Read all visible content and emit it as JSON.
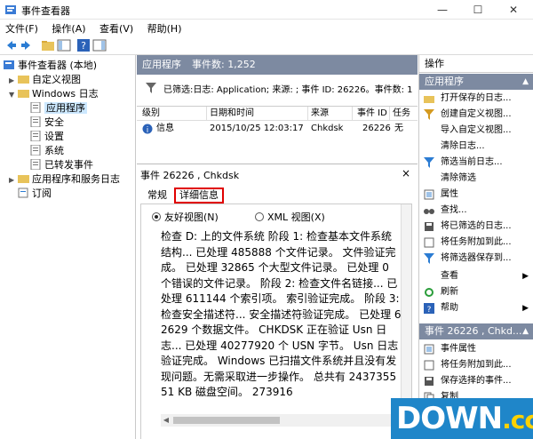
{
  "window": {
    "title": "事件查看器",
    "minimize": "—",
    "maximize": "☐",
    "close": "✕"
  },
  "menu": [
    "文件(F)",
    "操作(A)",
    "查看(V)",
    "帮助(H)"
  ],
  "tree": {
    "items": [
      {
        "label": "事件查看器 (本地)"
      },
      {
        "label": "自定义视图"
      },
      {
        "label": "Windows 日志"
      },
      {
        "label": "应用程序"
      },
      {
        "label": "安全"
      },
      {
        "label": "设置"
      },
      {
        "label": "系统"
      },
      {
        "label": "已转发事件"
      },
      {
        "label": "应用程序和服务日志"
      },
      {
        "label": "订阅"
      }
    ]
  },
  "main": {
    "header_title": "应用程序",
    "event_count": "事件数: 1,252",
    "filter_text": "已筛选:日志: Application; 来源: ; 事件 ID: 26226。事件数: 1",
    "columns": [
      "级别",
      "日期和时间",
      "来源",
      "事件 ID",
      "任务"
    ],
    "row": {
      "level": "信息",
      "datetime": "2015/10/25 12:03:17",
      "source": "Chkdsk",
      "event_id": "26226",
      "task": "无"
    }
  },
  "detail": {
    "title": "事件 26226 , Chkdsk",
    "close": "×",
    "tabs": [
      "常规",
      "详细信息"
    ],
    "radio_friendly": "友好视图(N)",
    "radio_xml": "XML 视图(X)",
    "text": "检查 D: 上的文件系统 阶段 1: 检查基本文件系统结构... 已处理 485888 个文件记录。 文件验证完成。 已处理 32865 个大型文件记录。 已处理 0 个错误的文件记录。 阶段 2: 检查文件名链接... 已处理 611144 个索引项。 索引验证完成。 阶段 3: 检查安全描述符... 安全描述符验证完成。 已处理 62629 个数据文件。 CHKDSK 正在验证 Usn 日志... 已处理 40277920 个 USN 字节。 Usn 日志验证完成。 Windows 已扫描文件系统并且没有发现问题。无需采取进一步操作。 总共有 243735551 KB 磁盘空间。 273916"
  },
  "actions": {
    "title": "操作",
    "group1": "应用程序",
    "group1_items": [
      "打开保存的日志...",
      "创建自定义视图...",
      "导入自定义视图...",
      "清除日志...",
      "筛选当前日志...",
      "清除筛选",
      "属性",
      "查找...",
      "将已筛选的日志...",
      "将任务附加到此...",
      "将筛选器保存到...",
      "查看",
      "刷新",
      "帮助"
    ],
    "group2": "事件 26226 , Chkd...",
    "group2_items": [
      "事件属性",
      "将任务附加到此...",
      "保存选择的事件...",
      "复制"
    ]
  },
  "watermark": {
    "main": "DOWN",
    "suffix": ".cc"
  }
}
